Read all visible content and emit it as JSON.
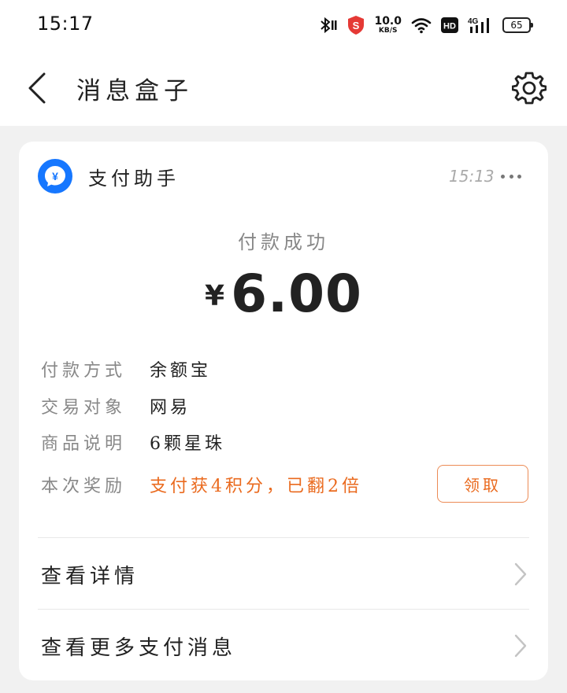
{
  "status_bar": {
    "time": "15:17",
    "net_speed_value": "10.0",
    "net_speed_unit": "KB/S",
    "network_type": "4G",
    "hd_label": "HD",
    "battery": "65",
    "icons": [
      "bluetooth-icon",
      "security-shield-icon",
      "wifi-icon",
      "hd-icon",
      "signal-icon",
      "battery-icon"
    ]
  },
  "nav": {
    "title": "消息盒子",
    "back_icon": "chevron-left-icon",
    "settings_icon": "gear-icon"
  },
  "message": {
    "sender": "支付助手",
    "avatar_symbol": "¥",
    "avatar_color": "#1677ff",
    "time": "15:13",
    "status": "付款成功",
    "currency": "¥",
    "amount": "6.00",
    "details": [
      {
        "label": "付款方式",
        "value": "余额宝"
      },
      {
        "label": "交易对象",
        "value": "网易"
      },
      {
        "label": "商品说明",
        "value": "6颗星珠"
      },
      {
        "label": "本次奖励",
        "value": "支付获4积分，已翻2倍"
      }
    ],
    "reward_color": "#ea6a1e",
    "claim_button": "领取",
    "links": [
      {
        "label": "查看详情"
      },
      {
        "label": "查看更多支付消息"
      }
    ]
  }
}
